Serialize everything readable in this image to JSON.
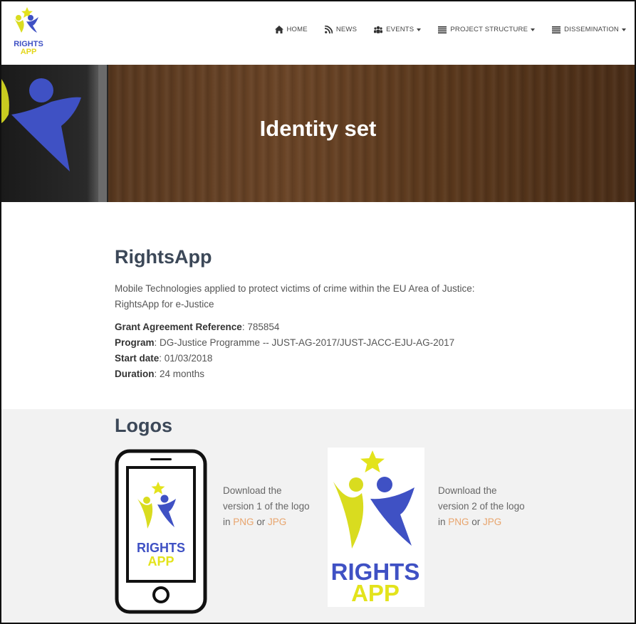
{
  "brand": {
    "line1": "RIGHTS",
    "line2": "APP"
  },
  "nav": {
    "items": [
      {
        "label": "HOME",
        "icon": "home-icon",
        "dropdown": false
      },
      {
        "label": "NEWS",
        "icon": "rss-icon",
        "dropdown": false
      },
      {
        "label": "EVENTS",
        "icon": "users-icon",
        "dropdown": true
      },
      {
        "label": "PROJECT STRUCTURE",
        "icon": "list-icon",
        "dropdown": true
      },
      {
        "label": "DISSEMINATION",
        "icon": "list-icon",
        "dropdown": true
      }
    ]
  },
  "hero": {
    "title": "Identity set"
  },
  "project": {
    "title": "RightsApp",
    "description": "Mobile Technologies applied to protect victims of crime within the EU Area of Justice: RightsApp for e-Justice",
    "grant_label": "Grant Agreement Reference",
    "grant_value": ": 785854",
    "program_label": "Program",
    "program_value": ": DG-Justice Programme -- JUST-AG-2017/JUST-JACC-EJU-AG-2017",
    "start_label": "Start date",
    "start_value": ": 01/03/2018",
    "duration_label": "Duration",
    "duration_value": ": 24 months"
  },
  "logos": {
    "title": "Logos",
    "v1": {
      "line1": "Download the",
      "line2": "version 1 of the logo",
      "in": "in ",
      "png": "PNG",
      "or": " or ",
      "jpg": "JPG"
    },
    "v2": {
      "line1": "Download the",
      "line2": "version 2 of the logo",
      "in": "in ",
      "png": "PNG",
      "or": " or ",
      "jpg": "JPG"
    },
    "logo_text1": "RIGHTS",
    "logo_text2": "APP"
  },
  "colors": {
    "accent_blue": "#3f51c4",
    "accent_yellow": "#e3e31c",
    "link": "#e8a46c"
  }
}
